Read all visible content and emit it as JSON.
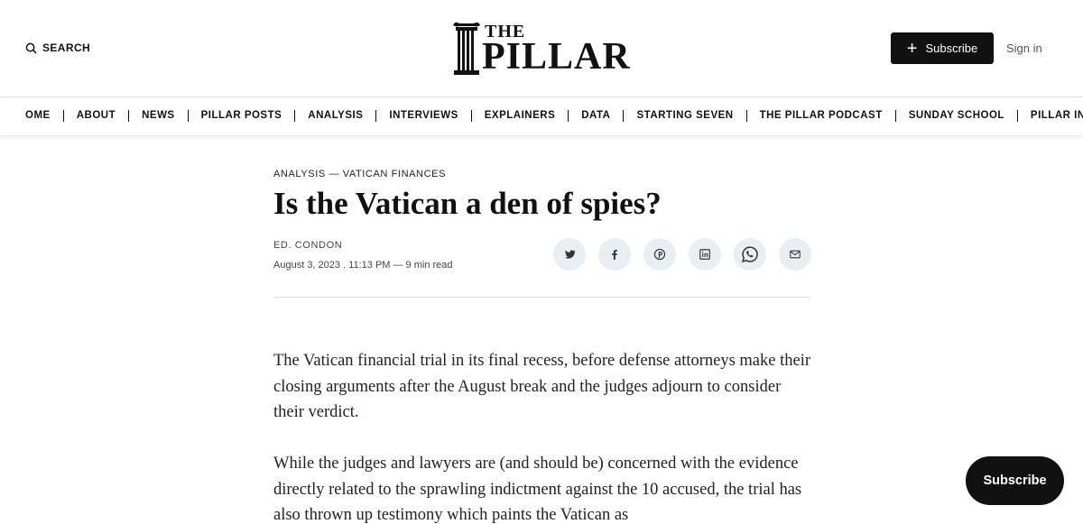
{
  "header": {
    "search_label": "SEARCH",
    "logo_the": "THE",
    "logo_pillar": "PILLAR",
    "subscribe_label": "Subscribe",
    "signin_label": "Sign in"
  },
  "nav": {
    "items": [
      "OME",
      "ABOUT",
      "NEWS",
      "PILLAR POSTS",
      "ANALYSIS",
      "INTERVIEWS",
      "EXPLAINERS",
      "DATA",
      "STARTING SEVEN",
      "THE PILLAR PODCAST",
      "SUNDAY SCHOOL",
      "PILLAR INDEPT"
    ]
  },
  "article": {
    "kicker": "ANALYSIS — VATICAN FINANCES",
    "title": "Is the Vatican a den of spies?",
    "author": "ED. CONDON",
    "meta": "August 3, 2023 . 11:13 PM — 9 min read",
    "share_icons": [
      "twitter-icon",
      "facebook-icon",
      "pinterest-icon",
      "linkedin-icon",
      "whatsapp-icon",
      "email-icon"
    ],
    "paragraphs": [
      "The Vatican financial trial in its final recess, before defense attorneys make their closing arguments after the August break and the judges adjourn to consider their verdict.",
      "While the judges and lawyers are (and should be) concerned with the evidence directly related to the sprawling indictment against the 10 accused, the trial has also thrown up testimony which paints the Vatican as"
    ]
  },
  "floating": {
    "subscribe_label": "Subscribe"
  },
  "colors": {
    "primary": "#111111",
    "share_bg": "#e9eef2"
  }
}
